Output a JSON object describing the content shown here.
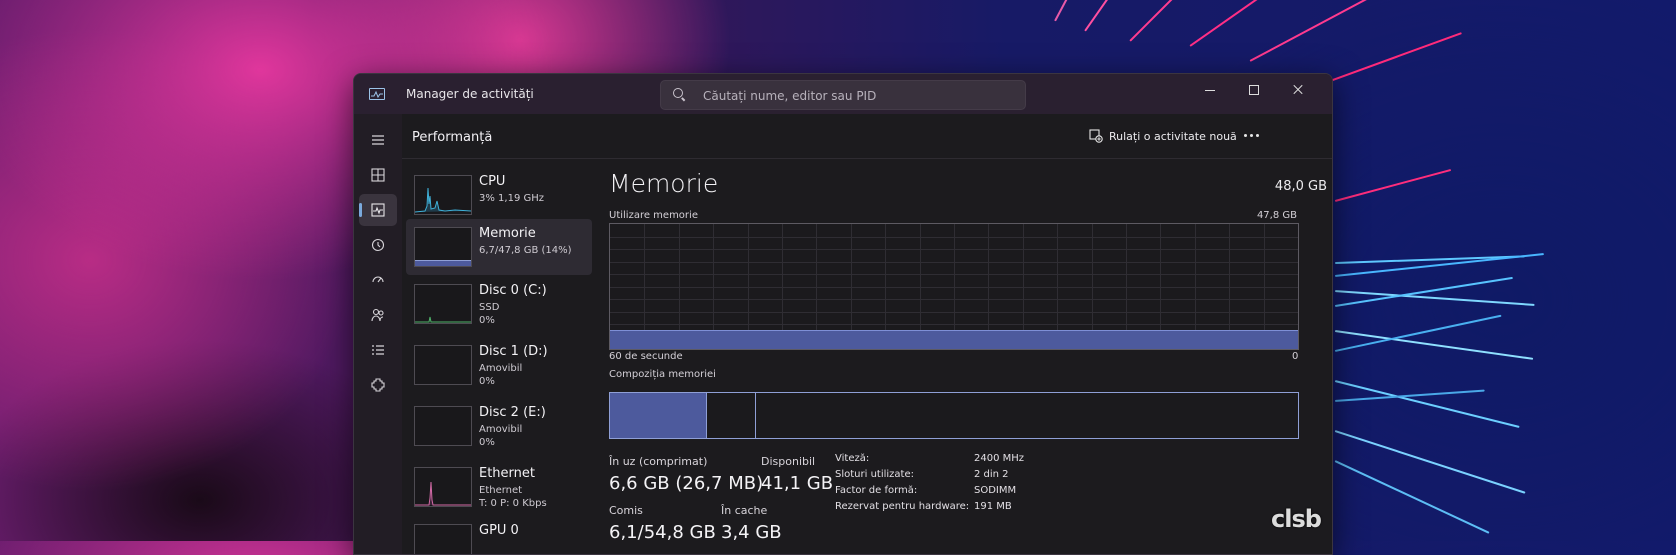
{
  "window": {
    "title": "Manager de activități"
  },
  "search": {
    "placeholder": "Căutați nume, editor sau PID"
  },
  "header": {
    "title": "Performanță",
    "run_task_label": "Rulați o activitate nouă"
  },
  "nav": {
    "items": [
      {
        "icon": "hamburger-menu-icon"
      },
      {
        "icon": "processes-icon"
      },
      {
        "icon": "performance-icon",
        "active": true
      },
      {
        "icon": "app-history-icon"
      },
      {
        "icon": "startup-apps-icon"
      },
      {
        "icon": "users-icon"
      },
      {
        "icon": "details-icon"
      },
      {
        "icon": "services-icon"
      }
    ]
  },
  "resources": [
    {
      "name": "CPU",
      "line1": "3%  1,19 GHz",
      "line2": ""
    },
    {
      "name": "Memorie",
      "line1": "6,7/47,8 GB (14%)",
      "line2": "",
      "active": true
    },
    {
      "name": "Disc 0 (C:)",
      "line1": "SSD",
      "line2": "0%"
    },
    {
      "name": "Disc 1 (D:)",
      "line1": "Amovibil",
      "line2": "0%"
    },
    {
      "name": "Disc 2 (E:)",
      "line1": "Amovibil",
      "line2": "0%"
    },
    {
      "name": "Ethernet",
      "line1": "Ethernet",
      "line2": "T: 0  P: 0 Kbps"
    },
    {
      "name": "GPU 0",
      "line1": "",
      "line2": ""
    }
  ],
  "memory": {
    "title": "Memorie",
    "total": "48,0 GB",
    "usage_label": "Utilizare memorie",
    "usage_max": "47,8 GB",
    "time_label": "60 de secunde",
    "zero_label": "0",
    "usage_fraction": 0.14,
    "composition_label": "Compoziția memoriei",
    "composition": {
      "in_use_fraction": 0.14,
      "modified_fraction": 0.07
    },
    "stats": {
      "in_use_label": "În uz (comprimat)",
      "in_use_value": "6,6 GB (26,7 MB)",
      "available_label": "Disponibil",
      "available_value": "41,1 GB",
      "committed_label": "Comis",
      "committed_value": "6,1/54,8 GB",
      "cached_label": "În cache",
      "cached_value": "3,4 GB"
    },
    "specs": [
      {
        "key": "Viteză:",
        "value": "2400 MHz"
      },
      {
        "key": "Sloturi utilizate:",
        "value": "2 din 2"
      },
      {
        "key": "Factor de formă:",
        "value": "SODIMM"
      },
      {
        "key": "Rezervat pentru hardware:",
        "value": "191 MB"
      }
    ]
  },
  "colors": {
    "accent": "#7aa9dc",
    "memory_fill": "#4d5a9d",
    "memory_border": "#8f9fd6"
  },
  "watermark": "clsb"
}
